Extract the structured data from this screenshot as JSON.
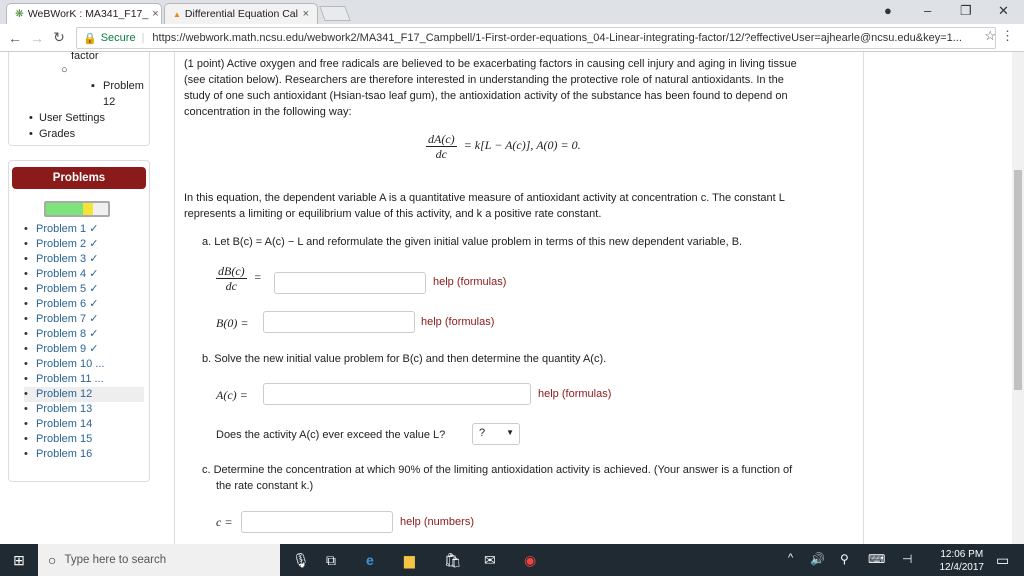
{
  "browser": {
    "tabs": [
      {
        "title": "WeBWorK : MA341_F17_",
        "active": true
      },
      {
        "title": "Differential Equation Cal",
        "active": false
      }
    ],
    "secure_label": "Secure",
    "url": "https://webwork.math.ncsu.edu/webwork2/MA341_F17_Campbell/1-First-order-equations_04-Linear-integrating-factor/12/?effectiveUser=ajhearle@ncsu.edu&key=1..."
  },
  "sidebar": {
    "top_items": {
      "factor": "factor",
      "problem_label": "Problem",
      "problem_num": "12",
      "user_settings": "User Settings",
      "grades": "Grades"
    },
    "problems_header": "Problems",
    "progress_fraction": 0.75,
    "problems": [
      "Problem 1 ✓",
      "Problem 2 ✓",
      "Problem 3 ✓",
      "Problem 4 ✓",
      "Problem 5 ✓",
      "Problem 6 ✓",
      "Problem 7 ✓",
      "Problem 8 ✓",
      "Problem 9 ✓",
      "Problem 10 ...",
      "Problem 11 ...",
      "Problem 12",
      "Problem 13",
      "Problem 14",
      "Problem 15",
      "Problem 16"
    ],
    "current_problem_index": 11
  },
  "problem": {
    "intro_1": "(1 point) Active oxygen and free radicals are believed to be exacerbating factors in causing cell injury and aging in living tissue",
    "intro_2": "(see citation below). Researchers are therefore interested in understanding the protective role of natural antioxidants. In the",
    "intro_3": "study of one such antioxidant (Hsian-tsao leaf gum), the antioxidation activity of the substance has been found to depend on",
    "intro_4": "concentration in the following way:",
    "eq_num": "dA(c)",
    "eq_den": "dc",
    "eq_rhs": "= k[L − A(c)],   A(0) = 0.",
    "para_1": "In this equation, the dependent variable A is a quantitative measure of antioxidant activity at concentration c. The constant L",
    "para_2": "represents a limiting or equilibrium value of this activity, and k a positive rate constant.",
    "part_a": "a. Let B(c) = A(c) − L and reformulate the given initial value problem in terms of this new dependent variable, B.",
    "dB_num": "dB(c)",
    "dB_den": "dc",
    "eq_sign": "=",
    "b0_label": "B(0) =",
    "help_formulas": "help (formulas)",
    "part_b": "b. Solve the new initial value problem for B(c) and then determine the quantity A(c).",
    "ac_label": "A(c) =",
    "exceed_q": "Does the activity A(c) ever exceed the value L?",
    "select_value": "?",
    "part_c_1": "c. Determine the concentration at which 90% of the limiting antioxidation activity is achieved. (Your answer is a function of",
    "part_c_2": "the rate constant k.)",
    "c_label": "c =",
    "help_numbers": "help (numbers)"
  },
  "taskbar": {
    "search_placeholder": "Type here to search",
    "time": "12:06 PM",
    "date": "12/4/2017"
  }
}
